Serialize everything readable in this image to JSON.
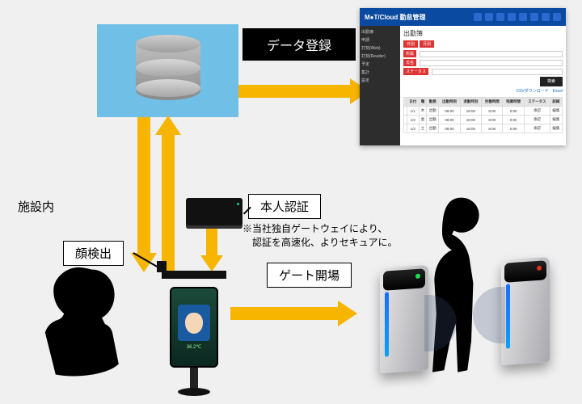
{
  "labels": {
    "data_register": "データ登録",
    "facility_inside": "施設内",
    "identity_auth": "本人認証",
    "face_detect": "顔検出",
    "gate_open": "ゲート開場",
    "gateway_note1": "※当社独自ゲートウェイにより、",
    "gateway_note2": "　認証を高速化、よりセキュアに。"
  },
  "dashboard": {
    "logo": "M●T/Cloud 勤怠管理",
    "icon_count": 8,
    "sidebar": [
      "出勤簿",
      "申請",
      "打刻(Web)",
      "打刻(Reader)",
      "予定",
      "集計",
      "設定"
    ],
    "title": "出勤簿",
    "tabs": [
      "日別",
      "月別"
    ],
    "form_labels": [
      "所属",
      "氏名",
      "ステータス"
    ],
    "search_btn": "検索",
    "links": "CSVダウンロード　Excel",
    "table": {
      "head": [
        "",
        "日付",
        "曜",
        "勤務",
        "出勤時刻",
        "退勤時刻",
        "労働時間",
        "残業時間",
        "ステータス",
        "詳細"
      ],
      "rows": [
        [
          "",
          "1/1",
          "木",
          "出勤",
          "09:00",
          "18:00",
          "8:00",
          "0:00",
          "承認",
          "編集"
        ],
        [
          "",
          "1/2",
          "金",
          "出勤",
          "09:00",
          "18:00",
          "8:00",
          "0:00",
          "承認",
          "編集"
        ],
        [
          "",
          "1/3",
          "土",
          "出勤",
          "09:00",
          "18:00",
          "8:00",
          "0:00",
          "承認",
          "編集"
        ]
      ]
    }
  },
  "icons": {
    "database": "database-icon",
    "gateway_device": "gateway-device-icon",
    "face_kiosk": "face-recognition-kiosk-icon",
    "speed_gate": "speed-gate-icon",
    "silhouette_user": "person-silhouette-icon",
    "silhouette_walker": "person-walking-icon"
  },
  "colors": {
    "arrow": "#f7b500",
    "cloud_bg": "#6fbfe6",
    "dash_header": "#0a4aa0"
  }
}
